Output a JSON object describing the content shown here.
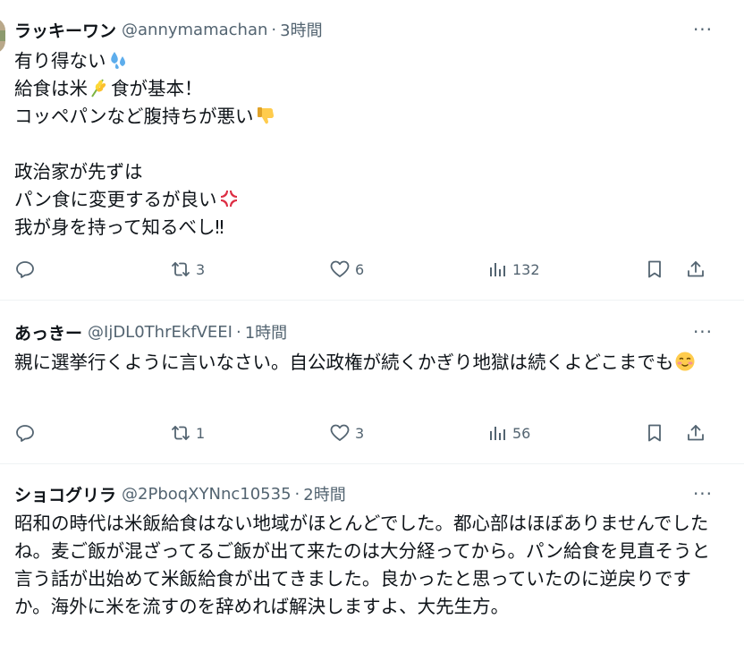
{
  "tweets": [
    {
      "name": "ラッキーワン",
      "handle": "@annymamachan",
      "sep": "·",
      "time": "3時間",
      "lines": [
        "有り得ない",
        "給食は米",
        "食が基本！",
        "コッペパンなど腹持ちが悪い",
        "政治家が先ずは",
        "パン食に変更するが良い",
        "我が身を持って知るべし‼"
      ],
      "counts": {
        "replies": "",
        "reposts": "3",
        "likes": "6",
        "views": "132"
      },
      "icons": [
        "sweat-droplets-icon",
        "rice-stalk-icon",
        "thumbs-down-icon",
        "anger-symbol-icon"
      ]
    },
    {
      "name": "あっきー",
      "handle": "@IjDL0ThrEkfVEEI",
      "sep": "·",
      "time": "1時間",
      "text": "親に選挙行くように言いなさい。自公政権が続くかぎり地獄は続くよどこまでも",
      "counts": {
        "replies": "",
        "reposts": "1",
        "likes": "3",
        "views": "56"
      },
      "icons": [
        "smiling-blush-face-icon"
      ]
    },
    {
      "name": "ショコグリラ",
      "handle": "@2PboqXYNnc10535",
      "sep": "·",
      "time": "2時間",
      "text": "昭和の時代は米飯給食はない地域がほとんどでした。都心部はほぼありませんでしたね。麦ご飯が混ざってるご飯が出て来たのは大分経ってから。パン給食を見直そうと言う話が出始めて米飯給食が出てきました。良かったと思っていたのに逆戻りですか。海外に米を流すのを辞めれば解決しますよ、大先生方。"
    }
  ],
  "more_label": "···",
  "colors": {
    "text": "#0f1419",
    "secondary": "#536471",
    "divider": "#eff3f4"
  }
}
